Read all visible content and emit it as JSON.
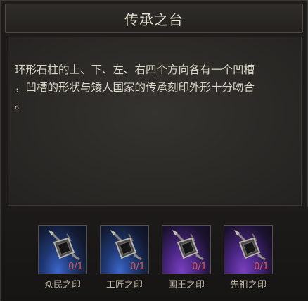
{
  "dialog": {
    "title": "传承之台",
    "description": "环形石柱的上、下、左、右四个方向各有一个凹槽\n，凹槽的形状与矮人国家的传承刻印外形十分吻合\n。"
  },
  "items": [
    {
      "label": "众民之印",
      "count": "0/1",
      "rarity": "blue",
      "icon": "seal-icon"
    },
    {
      "label": "工匠之印",
      "count": "0/1",
      "rarity": "blue",
      "icon": "seal-icon"
    },
    {
      "label": "国王之印",
      "count": "0/1",
      "rarity": "purple",
      "icon": "seal-icon"
    },
    {
      "label": "先祖之印",
      "count": "0/1",
      "rarity": "purple",
      "icon": "seal-icon"
    }
  ],
  "colors": {
    "count_text": "#e05a4e",
    "rarity_blue": "#3c67c9",
    "rarity_purple": "#7a3fbe"
  }
}
